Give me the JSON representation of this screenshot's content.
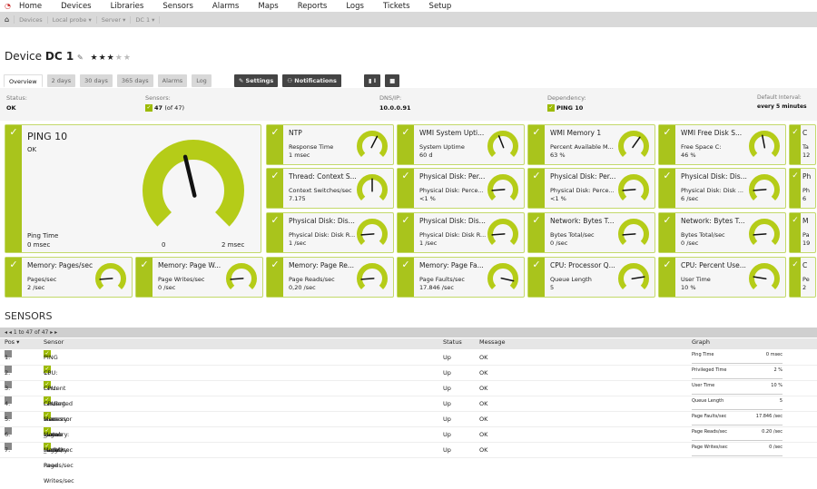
{
  "nav": {
    "items": [
      "Home",
      "Devices",
      "Libraries",
      "Sensors",
      "Alarms",
      "Maps",
      "Reports",
      "Logs",
      "Tickets",
      "Setup"
    ]
  },
  "breadcrumb": [
    "Devices",
    "Local probe ▾",
    "Server ▾",
    "DC 1 ▾"
  ],
  "device": {
    "prefix": "Device",
    "name": "DC 1",
    "stars": "★★★",
    "empty_stars": "★★"
  },
  "tabs": [
    "Overview",
    "2 days",
    "30 days",
    "365 days",
    "Alarms",
    "Log"
  ],
  "buttons": {
    "settings": "✎ Settings",
    "notifications": "⚇ Notifications",
    "comments": "▮ I",
    "extra": "■"
  },
  "info": {
    "status_label": "Status:",
    "status": "OK",
    "sensors_label": "Sensors:",
    "sensors": "47",
    "sensors_of": "(of 47)",
    "dns_label": "DNS/IP:",
    "dns": "10.0.0.91",
    "dep_label": "Dependency:",
    "dep": "PING 10",
    "interval_label": "Default Interval:",
    "interval": "every 5 minutes"
  },
  "big_tile": {
    "name": "PING 10",
    "status": "OK",
    "channel": "Ping Time",
    "value": "0 msec",
    "min": "0",
    "max": "2 msec",
    "gauge": 0.45
  },
  "tiles": [
    {
      "name": "NTP",
      "channel": "Response Time",
      "value": "1 msec",
      "gauge": 0.6
    },
    {
      "name": "WMI System Upti...",
      "channel": "System Uptime",
      "value": "60 d",
      "gauge": 0.42
    },
    {
      "name": "WMI Memory 1",
      "channel": "Percent Available M...",
      "value": "63 %",
      "gauge": 0.63
    },
    {
      "name": "WMI Free Disk S...",
      "channel": "Free Space C:",
      "value": "46 %",
      "gauge": 0.46
    },
    {
      "name": "C",
      "channel": "Ta",
      "value": "12",
      "gauge": 0.5
    },
    {
      "name": "Thread: Context S...",
      "channel": "Context Switches/sec",
      "value": "7.175",
      "gauge": 0.5
    },
    {
      "name": "Physical Disk: Per...",
      "channel": "Physical Disk: Perce...",
      "value": "<1 %",
      "gauge": 0.15
    },
    {
      "name": "Physical Disk: Per...",
      "channel": "Physical Disk: Perce...",
      "value": "<1 %",
      "gauge": 0.15
    },
    {
      "name": "Physical Disk: Dis...",
      "channel": "Physical Disk: Disk ...",
      "value": "6 /sec",
      "gauge": 0.15
    },
    {
      "name": "Ph",
      "channel": "Ph",
      "value": "6",
      "gauge": 0.15
    },
    {
      "name": "Physical Disk: Dis...",
      "channel": "Physical Disk: Disk R...",
      "value": "1 /sec",
      "gauge": 0.15
    },
    {
      "name": "Physical Disk: Dis...",
      "channel": "Physical Disk: Disk R...",
      "value": "1 /sec",
      "gauge": 0.15
    },
    {
      "name": "Network: Bytes T...",
      "channel": "Bytes Total/sec",
      "value": "0 /sec",
      "gauge": 0.15
    },
    {
      "name": "Network: Bytes T...",
      "channel": "Bytes Total/sec",
      "value": "0 /sec",
      "gauge": 0.15
    },
    {
      "name": "M",
      "channel": "Pa",
      "value": "19",
      "gauge": 0.15
    },
    {
      "name": "Memory: Pages/sec",
      "channel": "Pages/sec",
      "value": "2 /sec",
      "gauge": 0.15
    },
    {
      "name": "Memory: Page W...",
      "channel": "Page Writes/sec",
      "value": "0 /sec",
      "gauge": 0.15
    },
    {
      "name": "Memory: Page Re...",
      "channel": "Page Reads/sec",
      "value": "0,20 /sec",
      "gauge": 0.15
    },
    {
      "name": "Memory: Page Fa...",
      "channel": "Page Faults/sec",
      "value": "17.846 /sec",
      "gauge": 0.88
    },
    {
      "name": "CPU: Processor Q...",
      "channel": "Queue Length",
      "value": "5",
      "gauge": 0.8
    },
    {
      "name": "CPU: Percent Use...",
      "channel": "User Time",
      "value": "10 %",
      "gauge": 0.2
    },
    {
      "name": "C",
      "channel": "Pe",
      "value": "2",
      "gauge": 0.15
    }
  ],
  "sensors": {
    "heading": "SENSORS",
    "pager": "◂ ◂ 1 to 47 of 47 ▸ ▸",
    "columns": [
      "Pos ▾",
      "Sensor",
      "Status",
      "Message",
      "Graph"
    ],
    "rows": [
      {
        "pos": "1.",
        "name": "PING 10",
        "status": "Up",
        "message": "OK",
        "graph_label": "Ping Time",
        "graph_value": "0 msec"
      },
      {
        "pos": "2.",
        "name": "CPU: Percent Privileged Time _Total",
        "status": "Up",
        "message": "OK",
        "graph_label": "Privileged Time",
        "graph_value": "2 %"
      },
      {
        "pos": "3.",
        "name": "CPU: Percent User Time _Total",
        "status": "Up",
        "message": "OK",
        "graph_label": "User Time",
        "graph_value": "10 %"
      },
      {
        "pos": "4.",
        "name": "CPU: Processor Queue Length",
        "status": "Up",
        "message": "OK",
        "graph_label": "Queue Length",
        "graph_value": "5"
      },
      {
        "pos": "5.",
        "name": "Memory: Page Faults/sec",
        "status": "Up",
        "message": "OK",
        "graph_label": "Page Faults/sec",
        "graph_value": "17.846 /sec"
      },
      {
        "pos": "6.",
        "name": "Memory: Page Reads/sec",
        "status": "Up",
        "message": "OK",
        "graph_label": "Page Reads/sec",
        "graph_value": "0.20 /sec"
      },
      {
        "pos": "7.",
        "name": "Memory: Page Writes/sec",
        "status": "Up",
        "message": "OK",
        "graph_label": "Page Writes/sec",
        "graph_value": "0 /sec"
      }
    ]
  }
}
